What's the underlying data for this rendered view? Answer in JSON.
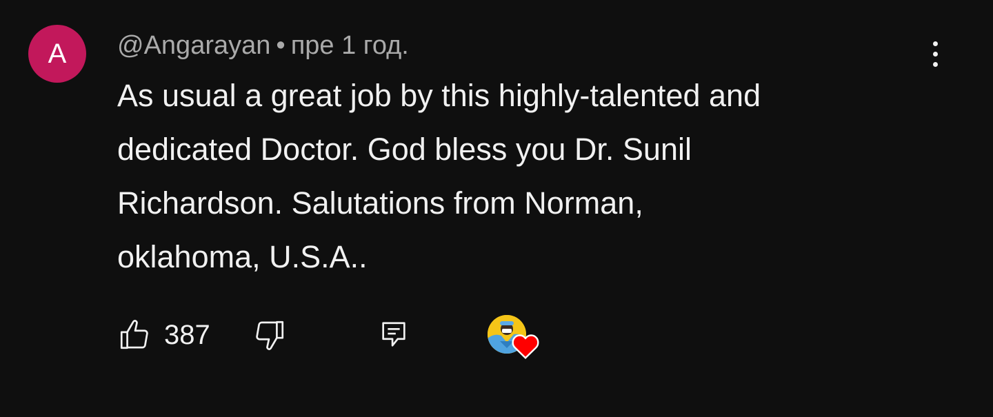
{
  "comment": {
    "avatar_letter": "A",
    "author": "@Angarayan",
    "separator": "•",
    "time": "пре 1 год.",
    "text": "As usual a great job by this highly-talented and\ndedicated Doctor.  God bless you Dr. Sunil\nRichardson.  Salutations from Norman,\noklahoma, U.S.A..",
    "like_count": "387",
    "icons": {
      "like": "thumbs-up-icon",
      "dislike": "thumbs-down-icon",
      "reply": "reply-comment-icon",
      "menu": "more-vert-icon",
      "creator_heart": "heart-icon"
    },
    "colors": {
      "avatar_bg": "#c2185b",
      "heart": "#ff0000",
      "background": "#0f0f0f"
    }
  }
}
